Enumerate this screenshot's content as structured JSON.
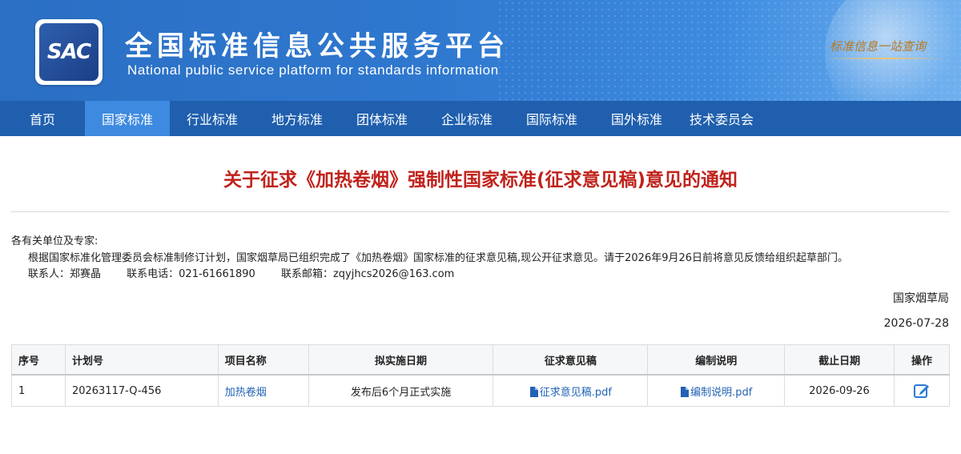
{
  "header": {
    "logo_text": "SAC",
    "title_cn": "全国标准信息公共服务平台",
    "title_en": "National public service platform  for standards information",
    "slogan": "标准信息一站查询"
  },
  "nav": {
    "items": [
      {
        "label": "首页"
      },
      {
        "label": "国家标准"
      },
      {
        "label": "行业标准"
      },
      {
        "label": "地方标准"
      },
      {
        "label": "团体标准"
      },
      {
        "label": "企业标准"
      },
      {
        "label": "国际标准"
      },
      {
        "label": "国外标准"
      },
      {
        "label": "技术委员会"
      }
    ],
    "active_index": 1
  },
  "notice": {
    "title": "关于征求《加热卷烟》强制性国家标准(征求意见稿)意见的通知",
    "salutation": "各有关单位及专家:",
    "body": "根据国家标准化管理委员会标准制修订计划，国家烟草局已组织完成了《加热卷烟》国家标准的征求意见稿,现公开征求意见。请于2026年9月26日前将意见反馈给组织起草部门。",
    "contact_person": "联系人：郑赛晶",
    "contact_phone": "联系电话：021-61661890",
    "contact_email": "联系邮箱：zqyjhcs2026@163.com",
    "signature": "国家烟草局",
    "date": "2026-07-28"
  },
  "table": {
    "headers": {
      "seq": "序号",
      "plan_no": "计划号",
      "project": "项目名称",
      "impl_date": "拟实施日期",
      "draft": "征求意见稿",
      "explanation": "编制说明",
      "deadline": "截止日期",
      "action": "操作"
    },
    "rows": [
      {
        "seq": "1",
        "plan_no": "20263117-Q-456",
        "project": "加热卷烟",
        "impl_date": "发布后6个月正式实施",
        "draft": "征求意见稿.pdf",
        "explanation": "编制说明.pdf",
        "deadline": "2026-09-26"
      }
    ]
  },
  "colors": {
    "banner": "#2f78cf",
    "nav": "#1f5fae",
    "nav_active": "#3d8ae0",
    "title_red": "#c0231c",
    "link_blue": "#2262b5"
  }
}
